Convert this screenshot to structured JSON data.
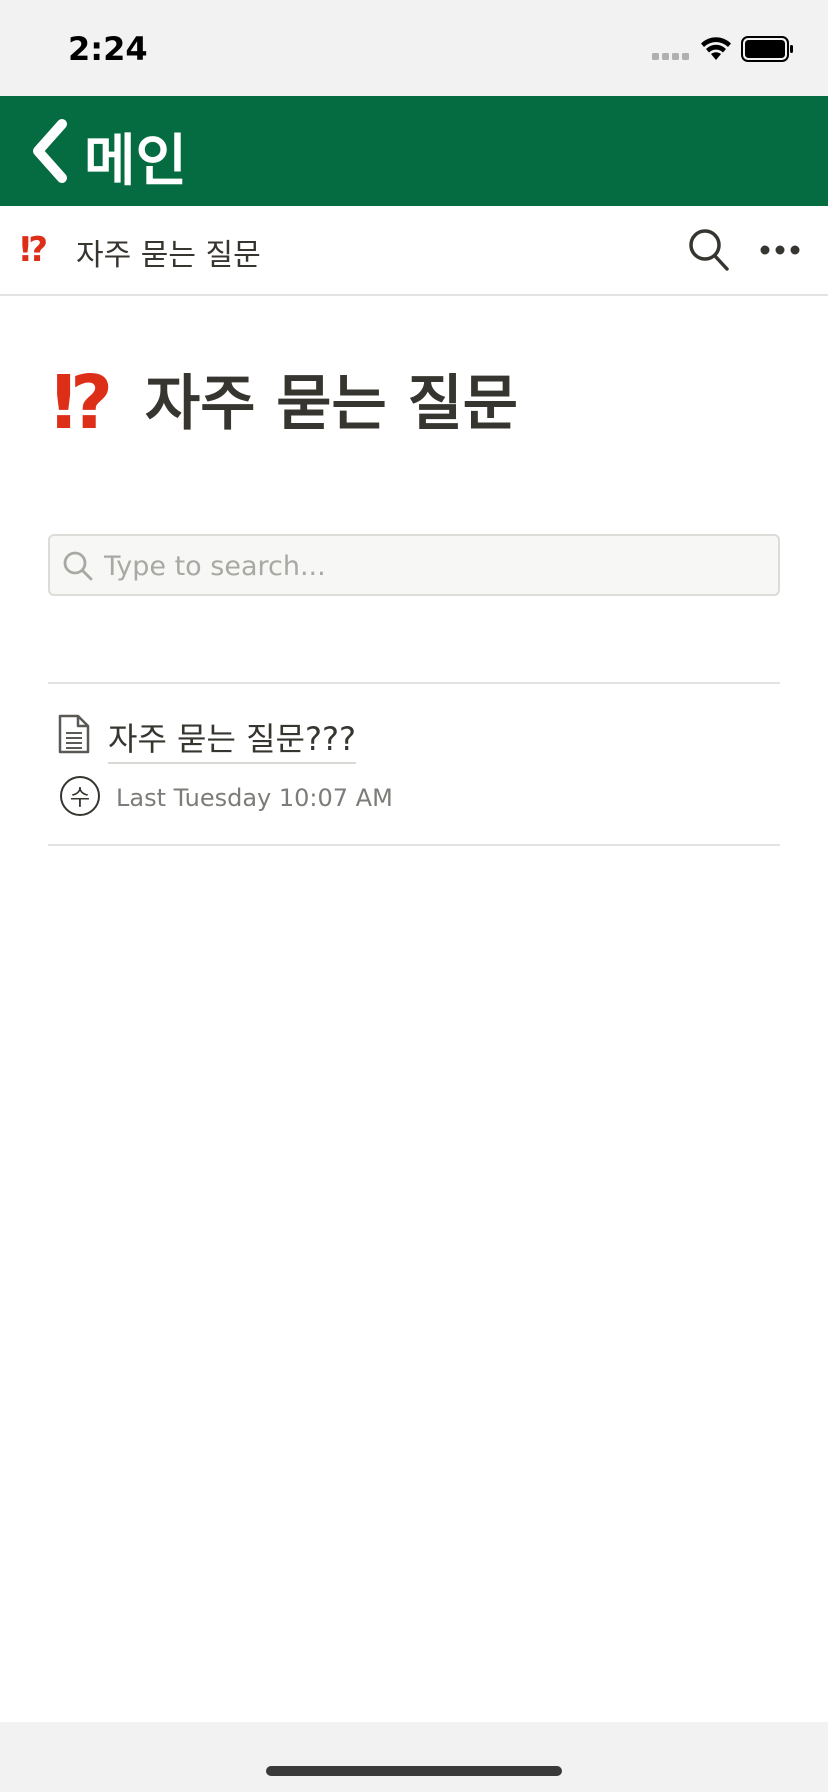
{
  "status_bar": {
    "time": "2:24"
  },
  "nav": {
    "back_label": "메인"
  },
  "header": {
    "emoji": "⁉",
    "title": "자주 묻는 질문"
  },
  "page": {
    "emoji": "⁉",
    "title": "자주 묻는 질문"
  },
  "search": {
    "placeholder": "Type to search..."
  },
  "items": [
    {
      "title": "자주 묻는 질문???",
      "avatar_initial": "수",
      "timestamp": "Last Tuesday 10:07 AM"
    }
  ],
  "icons": {
    "back": "chevron-left-icon",
    "search": "search-icon",
    "more": "more-icon",
    "document": "document-icon"
  },
  "colors": {
    "nav_background": "#056c41",
    "emoji": "#dd2e18",
    "text": "#37352f",
    "muted": "#7d7c78"
  }
}
